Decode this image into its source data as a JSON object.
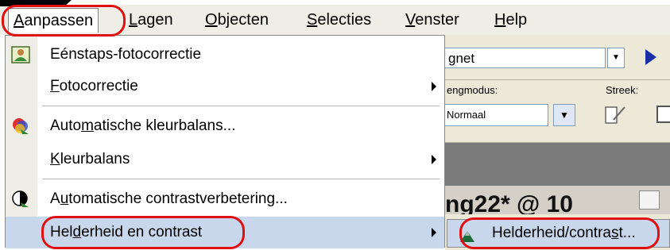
{
  "menubar": {
    "items": [
      {
        "pre": "",
        "key": "A",
        "post": "anpassen"
      },
      {
        "pre": "",
        "key": "L",
        "post": "agen"
      },
      {
        "pre": "",
        "key": "O",
        "post": "bjecten"
      },
      {
        "pre": "",
        "key": "S",
        "post": "electies"
      },
      {
        "pre": "",
        "key": "V",
        "post": "enster"
      },
      {
        "pre": "",
        "key": "H",
        "post": "elp"
      }
    ]
  },
  "menu": {
    "items": [
      {
        "pre": "Eénstaps-fotocorrectie",
        "key": "",
        "post": "",
        "icon": "photo-correction-icon",
        "submenu": false
      },
      {
        "pre": "",
        "key": "F",
        "post": "otocorrectie",
        "icon": "",
        "submenu": true
      },
      {
        "pre": "Auto",
        "key": "m",
        "post": "atische kleurbalans...",
        "icon": "color-balance-icon",
        "submenu": false
      },
      {
        "pre": "",
        "key": "K",
        "post": "leurbalans",
        "icon": "",
        "submenu": true
      },
      {
        "pre": "A",
        "key": "u",
        "post": "tomatische contrastverbetering...",
        "icon": "contrast-icon",
        "submenu": false
      },
      {
        "pre": "Hel",
        "key": "d",
        "post": "erheid en contrast",
        "icon": "",
        "submenu": true
      }
    ]
  },
  "submenu": {
    "item": {
      "pre": "Helderheid/contra",
      "key": "s",
      "post": "t..."
    },
    "icon": "brightness-contrast-icon"
  },
  "background": {
    "font_combo": "gnet",
    "mode_label": "engmodus:",
    "mode_value": "Normaal",
    "stroke_label": "Streek:",
    "doc_title": "ng22* @ 10"
  },
  "colors": {
    "annotation": "#e01010",
    "highlight": "#c8d7ec",
    "menu_gutter": "#eeeee6"
  }
}
